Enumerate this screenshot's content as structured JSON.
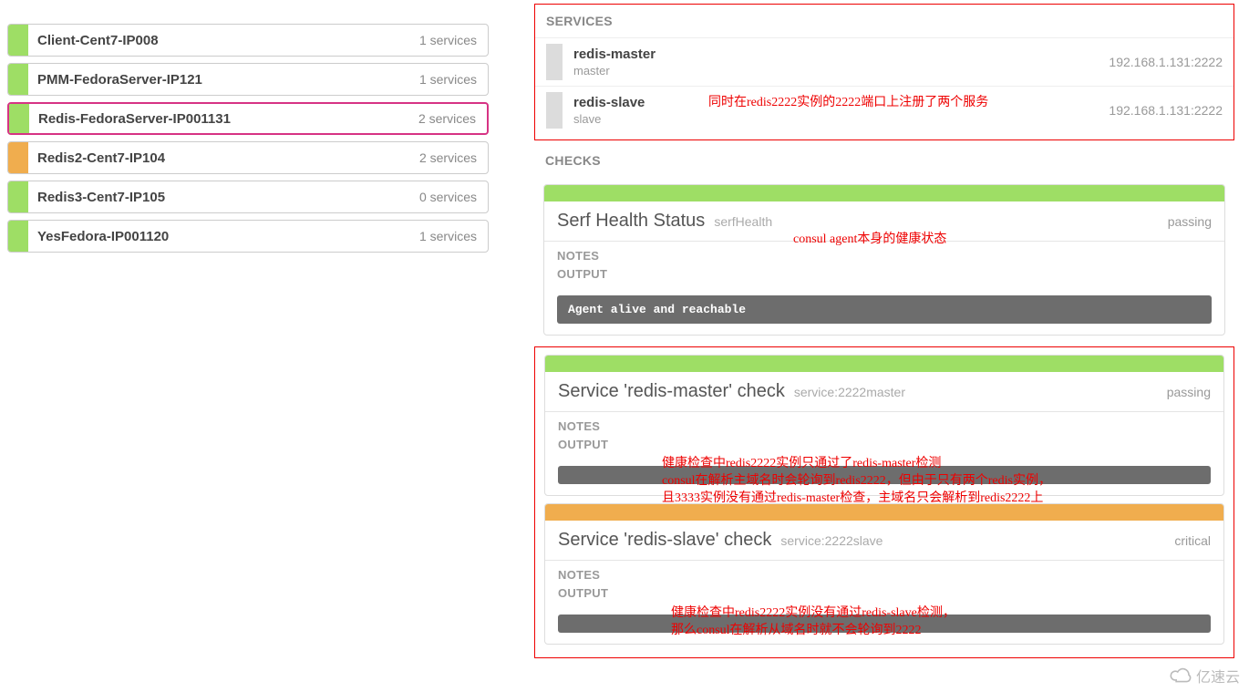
{
  "nodes": [
    {
      "name": "Client-Cent7-IP008",
      "services": "1 services",
      "color": "green",
      "selected": false
    },
    {
      "name": "PMM-FedoraServer-IP121",
      "services": "1 services",
      "color": "green",
      "selected": false
    },
    {
      "name": "Redis-FedoraServer-IP001131",
      "services": "2 services",
      "color": "green",
      "selected": true
    },
    {
      "name": "Redis2-Cent7-IP104",
      "services": "2 services",
      "color": "orange",
      "selected": false
    },
    {
      "name": "Redis3-Cent7-IP105",
      "services": "0 services",
      "color": "green",
      "selected": false
    },
    {
      "name": "YesFedora-IP001120",
      "services": "1 services",
      "color": "green",
      "selected": false
    }
  ],
  "labels": {
    "services_header": "SERVICES",
    "checks_header": "CHECKS",
    "notes": "NOTES",
    "output": "OUTPUT"
  },
  "services": [
    {
      "name": "redis-master",
      "tag": "master",
      "addr": "192.168.1.131:2222"
    },
    {
      "name": "redis-slave",
      "tag": "slave",
      "addr": "192.168.1.131:2222"
    }
  ],
  "checks": [
    {
      "title": "Serf Health Status",
      "sub": "serfHealth",
      "status": "passing",
      "color": "green",
      "output": "Agent alive and reachable"
    },
    {
      "title": "Service 'redis-master' check",
      "sub": "service:2222master",
      "status": "passing",
      "color": "green",
      "output": ""
    },
    {
      "title": "Service 'redis-slave' check",
      "sub": "service:2222slave",
      "status": "critical",
      "color": "orange",
      "output": ""
    }
  ],
  "annotations": {
    "a1": "同时在redis2222实例的2222端口上注册了两个服务",
    "a2": "consul agent本身的健康状态",
    "a3_l1": "健康检查中redis2222实例只通过了redis-master检测",
    "a3_l2": "consul在解析主域名时会轮询到redis2222，但由于只有两个redis实例，",
    "a3_l3": "且3333实例没有通过redis-master检查，主域名只会解析到redis2222上",
    "a4_l1": "健康检查中redis2222实例没有通过redis-slave检测，",
    "a4_l2": "那么consul在解析从域名时就不会轮询到2222"
  },
  "watermark": "亿速云"
}
